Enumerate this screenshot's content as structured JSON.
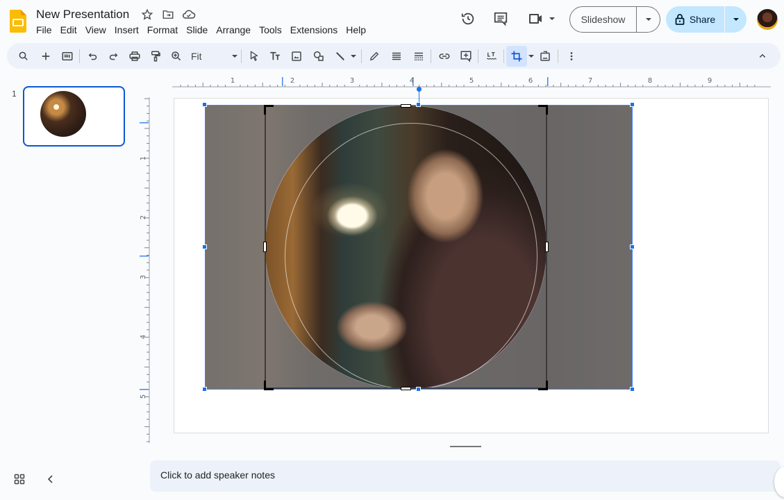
{
  "app": {
    "title": "New Presentation",
    "menu": [
      "File",
      "Edit",
      "View",
      "Insert",
      "Format",
      "Slide",
      "Arrange",
      "Tools",
      "Extensions",
      "Help"
    ],
    "brand_color": "#fbbc04",
    "accent_color": "#0b57d0"
  },
  "header": {
    "slideshow_label": "Slideshow",
    "share_label": "Share",
    "icons": [
      "star-icon",
      "move-to-folder-icon",
      "cloud-saved-icon",
      "version-history-icon",
      "comments-icon",
      "meet-camera-icon"
    ]
  },
  "toolbar": {
    "zoom_value": "Fit",
    "buttons": [
      "search-menus",
      "new-slide",
      "layout",
      "undo",
      "redo",
      "print",
      "paint-format",
      "zoom",
      "select",
      "text-box",
      "insert-image",
      "shape",
      "line",
      "border-color",
      "border-weight",
      "border-dash",
      "insert-link",
      "add-comment",
      "alt-text",
      "crop-image",
      "replace-image",
      "more",
      "collapse-toolbar"
    ],
    "active_tool": "crop-image"
  },
  "ruler": {
    "horizontal_labels": [
      "1",
      "2",
      "3",
      "4",
      "5",
      "6",
      "7",
      "8",
      "9"
    ],
    "vertical_labels": [
      "1",
      "2",
      "3",
      "4",
      "5"
    ]
  },
  "filmstrip": {
    "slides": [
      {
        "number": "1",
        "selected": true
      }
    ]
  },
  "canvas": {
    "mode": "crop",
    "mask_shape": "oval",
    "image_description": "Elderly man with glasses working at a workbench under a lamp"
  },
  "notes": {
    "placeholder": "Click to add speaker notes"
  }
}
